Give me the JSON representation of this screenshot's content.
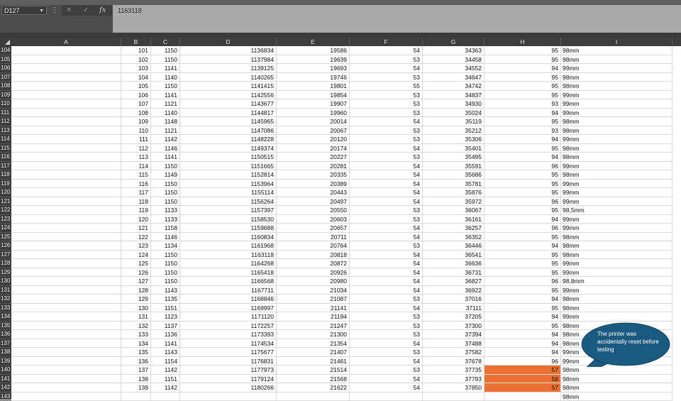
{
  "formula_bar": {
    "name_box": "D127",
    "formula": "1163118",
    "icons": [
      "cancel-x-icon",
      "confirm-check-icon",
      "function-fx-icon"
    ]
  },
  "columns": [
    "A",
    "B",
    "C",
    "D",
    "E",
    "F",
    "G",
    "H",
    "I"
  ],
  "rows": [
    {
      "row": "104",
      "B": "101",
      "C": "1150",
      "D": "1136834",
      "E": "19586",
      "F": "54",
      "G": "34363",
      "H": "95",
      "I": "98mm"
    },
    {
      "row": "105",
      "B": "102",
      "C": "1150",
      "D": "1137984",
      "E": "19639",
      "F": "53",
      "G": "34458",
      "H": "95",
      "I": "98mm"
    },
    {
      "row": "106",
      "B": "103",
      "C": "1141",
      "D": "1139125",
      "E": "19693",
      "F": "54",
      "G": "34552",
      "H": "94",
      "I": "99mm"
    },
    {
      "row": "107",
      "B": "104",
      "C": "1140",
      "D": "1140265",
      "E": "19746",
      "F": "53",
      "G": "34647",
      "H": "95",
      "I": "98mm"
    },
    {
      "row": "108",
      "B": "105",
      "C": "1150",
      "D": "1141415",
      "E": "19801",
      "F": "55",
      "G": "34742",
      "H": "95",
      "I": "98mm"
    },
    {
      "row": "109",
      "B": "106",
      "C": "1141",
      "D": "1142556",
      "E": "19854",
      "F": "53",
      "G": "34837",
      "H": "95",
      "I": "99mm"
    },
    {
      "row": "110",
      "B": "107",
      "C": "1121",
      "D": "1143677",
      "E": "19907",
      "F": "53",
      "G": "34930",
      "H": "93",
      "I": "99mm"
    },
    {
      "row": "111",
      "B": "108",
      "C": "1140",
      "D": "1144817",
      "E": "19960",
      "F": "53",
      "G": "35024",
      "H": "94",
      "I": "99mm"
    },
    {
      "row": "112",
      "B": "109",
      "C": "1148",
      "D": "1145965",
      "E": "20014",
      "F": "54",
      "G": "35119",
      "H": "95",
      "I": "98mm"
    },
    {
      "row": "113",
      "B": "110",
      "C": "1121",
      "D": "1147086",
      "E": "20067",
      "F": "53",
      "G": "35212",
      "H": "93",
      "I": "98mm"
    },
    {
      "row": "114",
      "B": "111",
      "C": "1142",
      "D": "1148228",
      "E": "20120",
      "F": "53",
      "G": "35306",
      "H": "94",
      "I": "99mm"
    },
    {
      "row": "115",
      "B": "112",
      "C": "1146",
      "D": "1149374",
      "E": "20174",
      "F": "54",
      "G": "35401",
      "H": "95",
      "I": "98mm"
    },
    {
      "row": "116",
      "B": "113",
      "C": "1141",
      "D": "1150515",
      "E": "20227",
      "F": "53",
      "G": "35495",
      "H": "94",
      "I": "98mm"
    },
    {
      "row": "117",
      "B": "114",
      "C": "1150",
      "D": "1151665",
      "E": "20281",
      "F": "54",
      "G": "35591",
      "H": "96",
      "I": "99mm"
    },
    {
      "row": "118",
      "B": "115",
      "C": "1149",
      "D": "1152814",
      "E": "20335",
      "F": "54",
      "G": "35686",
      "H": "95",
      "I": "98mm"
    },
    {
      "row": "119",
      "B": "116",
      "C": "1150",
      "D": "1153964",
      "E": "20389",
      "F": "54",
      "G": "35781",
      "H": "95",
      "I": "99mm"
    },
    {
      "row": "120",
      "B": "117",
      "C": "1150",
      "D": "1155114",
      "E": "20443",
      "F": "54",
      "G": "35876",
      "H": "95",
      "I": "99mm"
    },
    {
      "row": "121",
      "B": "118",
      "C": "1150",
      "D": "1156264",
      "E": "20497",
      "F": "54",
      "G": "35972",
      "H": "96",
      "I": "99mm"
    },
    {
      "row": "122",
      "B": "119",
      "C": "1133",
      "D": "1157397",
      "E": "20550",
      "F": "53",
      "G": "36067",
      "H": "95",
      "I": "98,5mm"
    },
    {
      "row": "123",
      "B": "120",
      "C": "1133",
      "D": "1158530",
      "E": "20603",
      "F": "53",
      "G": "36161",
      "H": "94",
      "I": "99mm"
    },
    {
      "row": "124",
      "B": "121",
      "C": "1158",
      "D": "1159688",
      "E": "20657",
      "F": "54",
      "G": "36257",
      "H": "96",
      "I": "99mm"
    },
    {
      "row": "125",
      "B": "122",
      "C": "1146",
      "D": "1160834",
      "E": "20711",
      "F": "54",
      "G": "36352",
      "H": "95",
      "I": "98mm"
    },
    {
      "row": "126",
      "B": "123",
      "C": "1134",
      "D": "1161968",
      "E": "20764",
      "F": "53",
      "G": "36446",
      "H": "94",
      "I": "98mm"
    },
    {
      "row": "127",
      "B": "124",
      "C": "1150",
      "D": "1163118",
      "E": "20818",
      "F": "54",
      "G": "36541",
      "H": "95",
      "I": "98mm"
    },
    {
      "row": "128",
      "B": "125",
      "C": "1150",
      "D": "1164268",
      "E": "20872",
      "F": "54",
      "G": "36636",
      "H": "95",
      "I": "99mm"
    },
    {
      "row": "129",
      "B": "126",
      "C": "1150",
      "D": "1165418",
      "E": "20926",
      "F": "54",
      "G": "36731",
      "H": "95",
      "I": "99mm"
    },
    {
      "row": "130",
      "B": "127",
      "C": "1150",
      "D": "1166568",
      "E": "20980",
      "F": "54",
      "G": "36827",
      "H": "96",
      "I": "98,8mm"
    },
    {
      "row": "131",
      "B": "128",
      "C": "1143",
      "D": "1167711",
      "E": "21034",
      "F": "54",
      "G": "36922",
      "H": "95",
      "I": "99mm"
    },
    {
      "row": "132",
      "B": "129",
      "C": "1135",
      "D": "1168846",
      "E": "21087",
      "F": "53",
      "G": "37016",
      "H": "94",
      "I": "98mm"
    },
    {
      "row": "133",
      "B": "130",
      "C": "1151",
      "D": "1169997",
      "E": "21141",
      "F": "54",
      "G": "37111",
      "H": "95",
      "I": "98mm"
    },
    {
      "row": "134",
      "B": "131",
      "C": "1123",
      "D": "1171120",
      "E": "21194",
      "F": "53",
      "G": "37205",
      "H": "94",
      "I": "99mm"
    },
    {
      "row": "135",
      "B": "132",
      "C": "1137",
      "D": "1172257",
      "E": "21247",
      "F": "53",
      "G": "37300",
      "H": "95",
      "I": "98mm"
    },
    {
      "row": "136",
      "B": "133",
      "C": "1136",
      "D": "1173393",
      "E": "21300",
      "F": "53",
      "G": "37394",
      "H": "94",
      "I": "98mm"
    },
    {
      "row": "137",
      "B": "134",
      "C": "1141",
      "D": "1174534",
      "E": "21354",
      "F": "54",
      "G": "37488",
      "H": "94",
      "I": "98mm"
    },
    {
      "row": "138",
      "B": "135",
      "C": "1143",
      "D": "1175677",
      "E": "21407",
      "F": "53",
      "G": "37582",
      "H": "94",
      "I": "99mm"
    },
    {
      "row": "139",
      "B": "136",
      "C": "1154",
      "D": "1176831",
      "E": "21461",
      "F": "54",
      "G": "37678",
      "H": "96",
      "I": "99mm"
    },
    {
      "row": "140",
      "B": "137",
      "C": "1142",
      "D": "1177973",
      "E": "21514",
      "F": "53",
      "G": "37735",
      "H": "57",
      "I": "98mm",
      "highlight": true
    },
    {
      "row": "141",
      "B": "138",
      "C": "1151",
      "D": "1179124",
      "E": "21568",
      "F": "54",
      "G": "37793",
      "H": "58",
      "I": "98mm",
      "highlight": true
    },
    {
      "row": "142",
      "B": "139",
      "C": "1142",
      "D": "1180266",
      "E": "21622",
      "F": "54",
      "G": "37850",
      "H": "57",
      "I": "98mm",
      "highlight": true
    },
    {
      "row": "143",
      "B": "",
      "C": "",
      "D": "",
      "E": "",
      "F": "",
      "G": "",
      "H": "",
      "I": "98mm"
    }
  ],
  "callout": {
    "text": "The printer was accidentally reset before testing",
    "fill": "#1a5a80",
    "highlight_color": "#ec7032"
  }
}
